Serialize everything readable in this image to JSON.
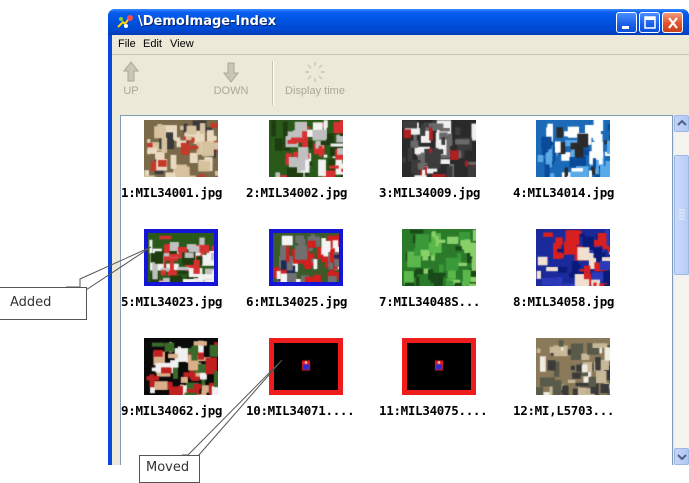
{
  "window": {
    "title": "\\DemoImage-Index",
    "app_icon": "demo-app-icon",
    "buttons": [
      "minimize-icon",
      "maximize-icon",
      "close-icon"
    ]
  },
  "menu": [
    {
      "label": "File"
    },
    {
      "label": "Edit"
    },
    {
      "label": "View"
    }
  ],
  "toolbar": {
    "up_label": "UP",
    "down_label": "DOWN",
    "display_time_label": "Display time"
  },
  "images": [
    {
      "label": "1:MIL34001.jpg",
      "border": "none",
      "palette": "track"
    },
    {
      "label": "2:MIL34002.jpg",
      "border": "none",
      "palette": "football-team"
    },
    {
      "label": "3:MIL34009.jpg",
      "border": "none",
      "palette": "football-dark"
    },
    {
      "label": "4:MIL34014.jpg",
      "border": "none",
      "palette": "water-ski"
    },
    {
      "label": "5:MIL34023.jpg",
      "border": "blue",
      "palette": "football-team"
    },
    {
      "label": "6:MIL34025.jpg",
      "border": "blue",
      "palette": "football-red"
    },
    {
      "label": "7:MIL34048S...",
      "border": "none",
      "palette": "clover"
    },
    {
      "label": "8:MIL34058.jpg",
      "border": "none",
      "palette": "sky-player"
    },
    {
      "label": "9:MIL34062.jpg",
      "border": "none",
      "palette": "soccer"
    },
    {
      "label": "10:MIL34071....",
      "border": "red",
      "palette": "placeholder"
    },
    {
      "label": "11:MIL34075....",
      "border": "red",
      "palette": "placeholder"
    },
    {
      "label": "12:MI,L5703...",
      "border": "none",
      "palette": "baseball"
    }
  ],
  "annotations": {
    "added": "Added",
    "moved": "Moved"
  },
  "colors": {
    "selection_blue": "#1515d8",
    "moved_red": "#ee1c1c",
    "title_bar": "#0054e3",
    "window_bg": "#ece9d8"
  }
}
